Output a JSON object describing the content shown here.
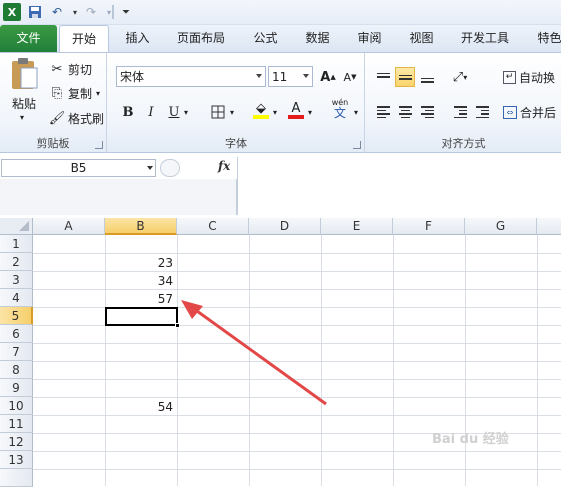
{
  "qat": {
    "excel_icon": "excel-icon",
    "save_icon": "save-icon",
    "undo_icon": "undo-icon",
    "redo_icon": "redo-icon",
    "customize_icon": "customize-icon"
  },
  "tabs": [
    {
      "label": "文件"
    },
    {
      "label": "开始"
    },
    {
      "label": "插入"
    },
    {
      "label": "页面布局"
    },
    {
      "label": "公式"
    },
    {
      "label": "数据"
    },
    {
      "label": "审阅"
    },
    {
      "label": "视图"
    },
    {
      "label": "开发工具"
    },
    {
      "label": "特色"
    }
  ],
  "clipboard": {
    "paste": "粘贴",
    "cut": "剪切",
    "copy": "复制",
    "format_painter": "格式刷",
    "group": "剪贴板"
  },
  "font": {
    "name": "宋体",
    "size": "11",
    "bold": "B",
    "italic": "I",
    "underline": "U",
    "grow": "A",
    "shrink": "A",
    "phonetic": "wén",
    "group": "字体"
  },
  "alignment": {
    "wrap": "自动换",
    "merge": "合并后",
    "group": "对齐方式"
  },
  "formula_bar": {
    "name_box": "B5",
    "fx": "fx",
    "value": ""
  },
  "grid": {
    "columns": [
      "A",
      "B",
      "C",
      "D",
      "E",
      "F",
      "G"
    ],
    "rows": [
      "1",
      "2",
      "3",
      "4",
      "5",
      "6",
      "7",
      "8",
      "9",
      "10",
      "11",
      "12",
      "13"
    ],
    "selected_col": "B",
    "selected_row": "5",
    "cells": [
      {
        "ref": "B2",
        "value": "23"
      },
      {
        "ref": "B3",
        "value": "34"
      },
      {
        "ref": "B4",
        "value": "57"
      },
      {
        "ref": "B10",
        "value": "54"
      }
    ]
  },
  "watermark": "Bai du 经验",
  "colors": {
    "file_tab": "#21803a",
    "selection_header": "#f7cf6b",
    "arrow": "#e34848"
  }
}
